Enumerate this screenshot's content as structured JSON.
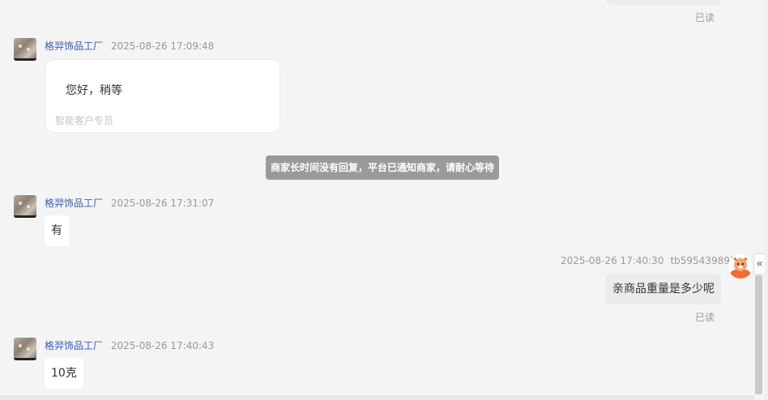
{
  "messages": {
    "read_status": "已读",
    "shop_name": "格羿饰品工厂",
    "msg1": {
      "time": "2025-08-26 17:09:48",
      "text": "您好，稍等",
      "signature": "智能客户专员"
    },
    "system_notice": "商家长时间没有回复，平台已通知商家，请耐心等待",
    "msg2": {
      "time": "2025-08-26 17:31:07",
      "text": "有"
    },
    "msg3": {
      "time": "2025-08-26 17:40:30",
      "user_id": "tb5954398910",
      "text": "亲商品重量是多少呢"
    },
    "msg4": {
      "time": "2025-08-26 17:40:43",
      "text": "10克"
    }
  },
  "collapse_icon_glyph": "«",
  "colors": {
    "shop_name": "#3b5bb5",
    "notice_bg": "#9a9a9a",
    "my_bubble_bg": "#ebebeb"
  }
}
